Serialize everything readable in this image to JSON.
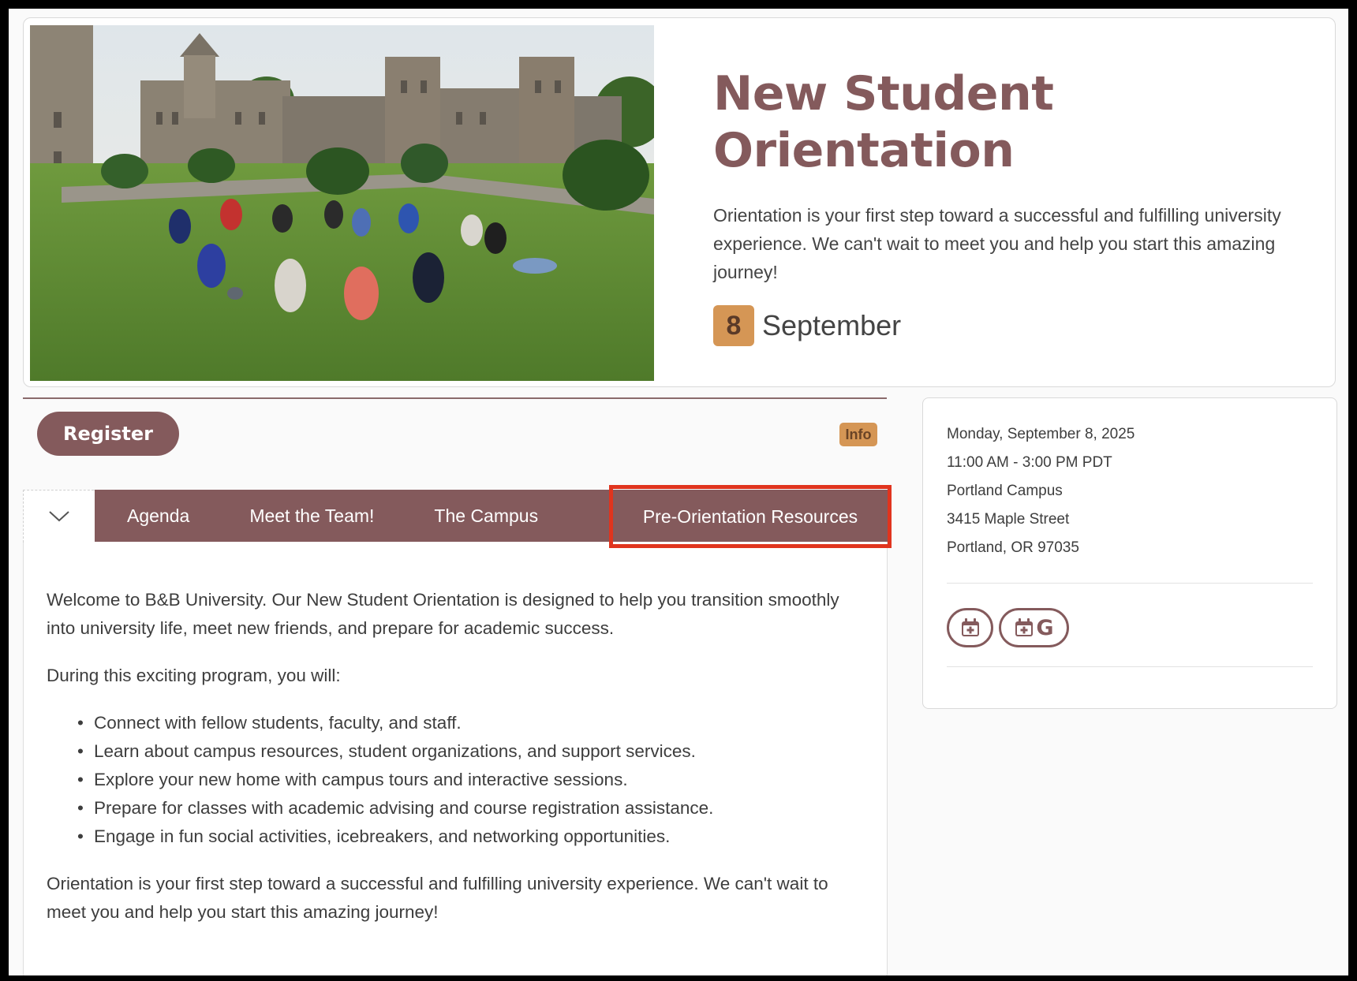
{
  "hero": {
    "title_line1": "New Student",
    "title_line2": "Orientation",
    "description": "Orientation is your first step toward a successful and fulfilling university experience. We can't wait to meet you and help you start this amazing journey!",
    "date_day": "8",
    "date_month": "September"
  },
  "actions": {
    "register_label": "Register",
    "info_label": "Info"
  },
  "tabs": [
    {
      "label": "Agenda"
    },
    {
      "label": "Meet the Team!"
    },
    {
      "label": "The Campus"
    },
    {
      "label": "Pre-Orientation Resources"
    }
  ],
  "content": {
    "intro": "Welcome to B&B University. Our New Student Orientation is designed to help you transition smoothly into university life, meet new friends, and prepare for academic success.",
    "lead": "During this exciting program, you will:",
    "bullets": [
      "Connect with fellow students, faculty, and staff.",
      "Learn about campus resources, student organizations, and support services.",
      "Explore your new home with campus tours and interactive sessions.",
      "Prepare for classes with academic advising and course registration assistance.",
      "Engage in fun social activities, icebreakers, and networking opportunities."
    ],
    "closing": "Orientation is your first step toward a successful and fulfilling university experience. We can't wait to meet you and help you start this amazing journey!"
  },
  "event_details": {
    "date": "Monday, September 8, 2025",
    "time": "11:00 AM - 3:00 PM PDT",
    "venue": "Portland Campus",
    "street": "3415 Maple Street",
    "city": "Portland, OR 97035",
    "google_letter": "G"
  },
  "colors": {
    "brand": "#845a5c",
    "accent": "#d59655",
    "highlight_border": "#e0341e"
  },
  "icons": {
    "photo": "campus-photo",
    "collapse": "chevron-down-icon",
    "add_calendar": "calendar-plus-icon",
    "google_calendar": "google-calendar-icon"
  }
}
